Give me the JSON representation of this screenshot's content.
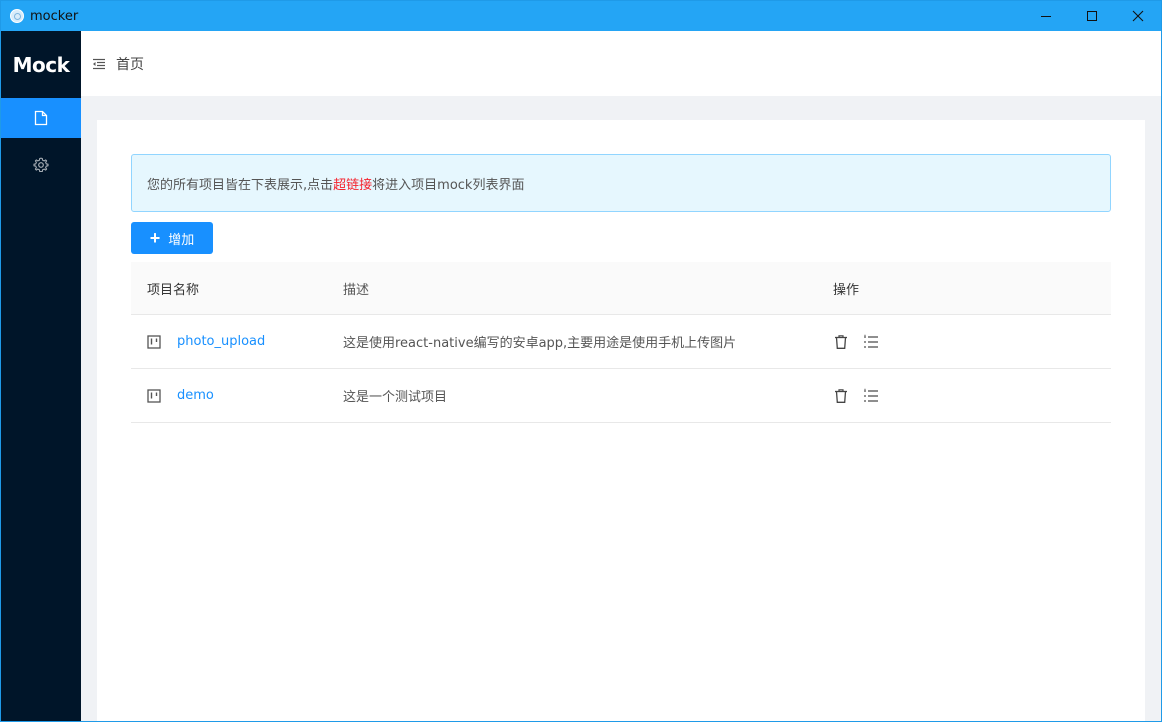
{
  "window": {
    "title": "mocker",
    "controls": [
      "minimize-icon",
      "maximize-icon",
      "close-icon"
    ]
  },
  "sidebar": {
    "logo": "Mock",
    "items": [
      {
        "icon": "file-icon",
        "active": true
      },
      {
        "icon": "gear-icon",
        "active": false
      }
    ]
  },
  "header": {
    "breadcrumb": "首页"
  },
  "alert": {
    "text_before": "您的所有项目皆在下表展示,点击",
    "highlight": "超链接",
    "text_after": "将进入项目mock列表界面"
  },
  "toolbar": {
    "add_label": "增加"
  },
  "table": {
    "columns": [
      "项目名称",
      "描述",
      "操作"
    ],
    "rows": [
      {
        "name": "photo_upload",
        "description": "这是使用react-native编写的安卓app,主要用途是使用手机上传图片"
      },
      {
        "name": "demo",
        "description": "这是一个测试项目"
      }
    ]
  },
  "colors": {
    "titlebar": "#24a5f5",
    "sidebar": "#001529",
    "accent": "#1890ff",
    "highlight": "#f5222d"
  }
}
